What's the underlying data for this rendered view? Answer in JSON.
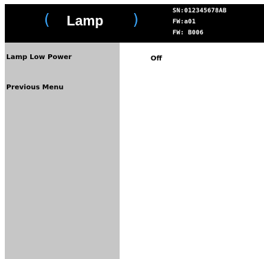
{
  "header": {
    "title": "Lamp",
    "paren_left": "(",
    "paren_right": ")",
    "serial": "SN:012345678AB",
    "fw1": "FW:a01",
    "fw2": "FW: B006"
  },
  "menu": {
    "items": [
      {
        "label": "Lamp Low Power",
        "value": "Off"
      },
      {
        "label": "Previous Menu"
      }
    ]
  },
  "colors": {
    "header_bg": "#000000",
    "sidebar_bg": "#c6c6c6",
    "accent_paren": "#3aa8ff"
  }
}
